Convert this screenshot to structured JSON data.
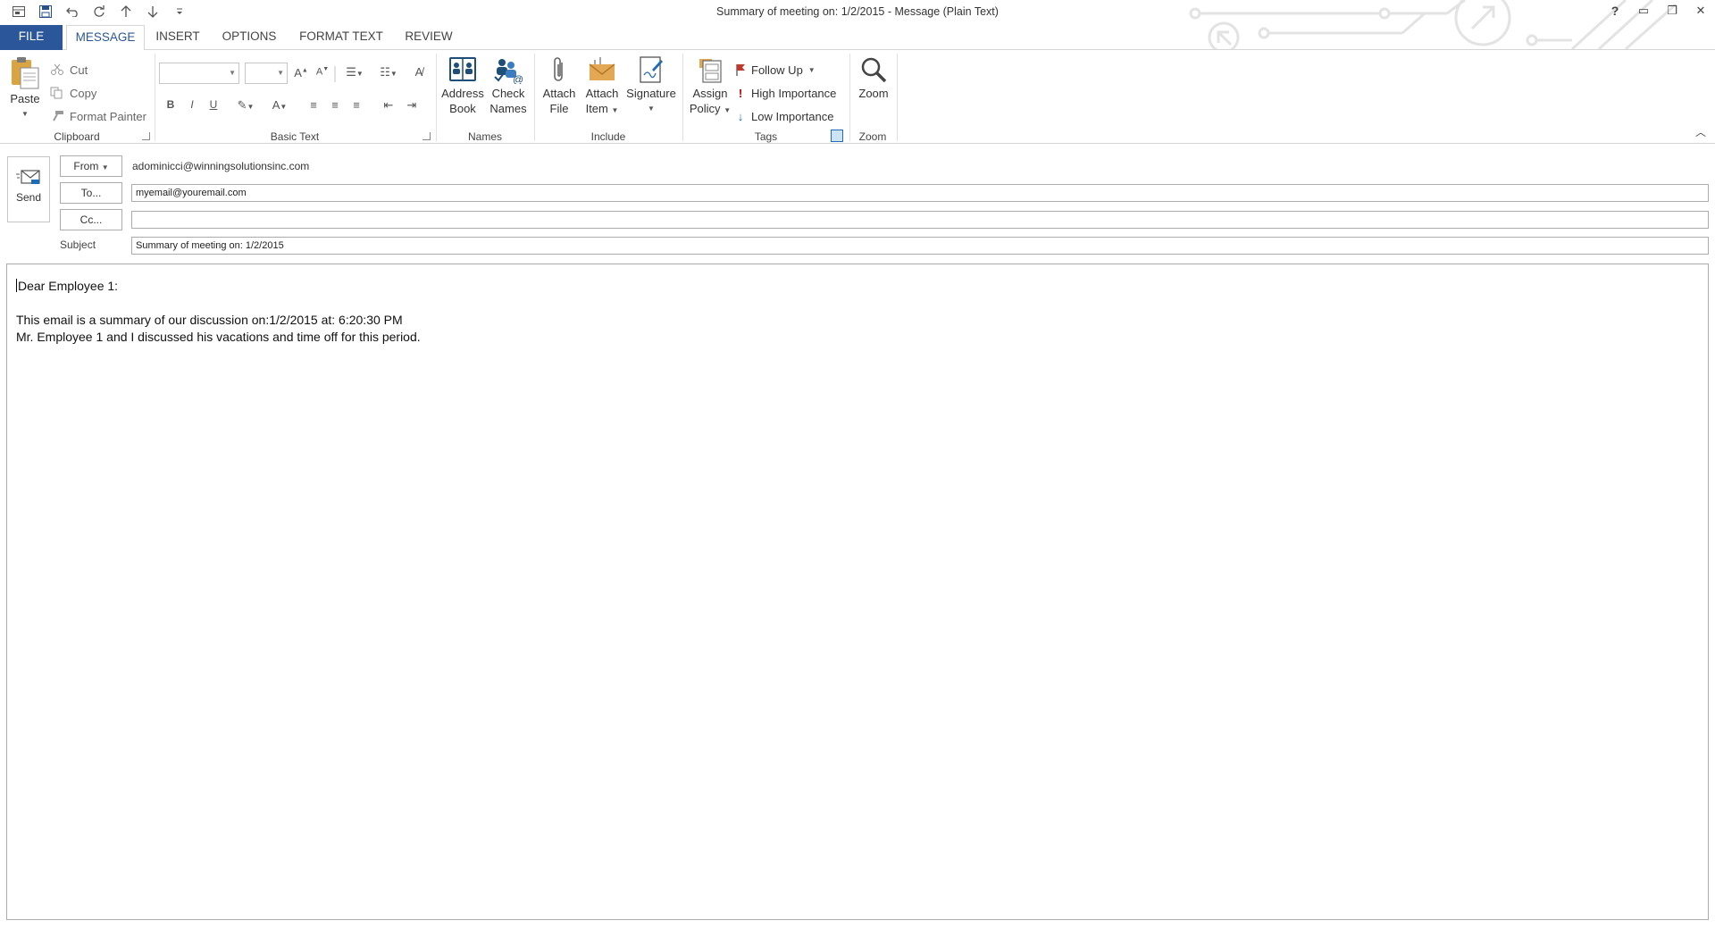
{
  "window": {
    "title": "Summary of meeting on: 1/2/2015 - Message (Plain Text)"
  },
  "quick_access": [
    {
      "name": "window-menu-icon"
    },
    {
      "name": "save-icon"
    },
    {
      "name": "undo-icon"
    },
    {
      "name": "redo-icon"
    },
    {
      "name": "up-arrow-icon"
    },
    {
      "name": "down-arrow-icon"
    },
    {
      "name": "customize-qat-icon"
    }
  ],
  "window_controls": {
    "help": "?",
    "ribbon_display": "▭",
    "restore": "❐",
    "close": "✕"
  },
  "tabs": [
    {
      "label": "FILE"
    },
    {
      "label": "MESSAGE"
    },
    {
      "label": "INSERT"
    },
    {
      "label": "OPTIONS"
    },
    {
      "label": "FORMAT TEXT"
    },
    {
      "label": "REVIEW"
    }
  ],
  "ribbon": {
    "clipboard": {
      "label": "Clipboard",
      "paste": "Paste",
      "cut": "Cut",
      "copy": "Copy",
      "format_painter": "Format Painter"
    },
    "basic_text": {
      "label": "Basic Text",
      "bold": "B",
      "italic": "I",
      "underline": "U"
    },
    "names": {
      "label": "Names",
      "address_book_1": "Address",
      "address_book_2": "Book",
      "check_names_1": "Check",
      "check_names_2": "Names"
    },
    "include": {
      "label": "Include",
      "attach_file_1": "Attach",
      "attach_file_2": "File",
      "attach_item_1": "Attach",
      "attach_item_2": "Item",
      "signature": "Signature"
    },
    "tags": {
      "label": "Tags",
      "assign_policy_1": "Assign",
      "assign_policy_2": "Policy",
      "follow_up": "Follow Up",
      "high_importance": "High Importance",
      "low_importance": "Low Importance"
    },
    "zoom": {
      "label": "Zoom",
      "zoom": "Zoom"
    }
  },
  "header": {
    "send_label": "Send",
    "from_label": "From",
    "from_value": "adominicci@winningsolutionsinc.com",
    "to_label": "To...",
    "to_value": "myemail@youremail.com",
    "cc_label": "Cc...",
    "cc_value": "",
    "subject_label": "Subject",
    "subject_value": "Summary of meeting on: 1/2/2015"
  },
  "body": {
    "line1": "Dear Employee 1:",
    "line2": "",
    "line3": "This email is a summary of our discussion on:1/2/2015 at: 6:20:30 PM",
    "line4": "Mr. Employee 1 and I discussed his vacations and time off for this period."
  },
  "colors": {
    "accent": "#2b579a",
    "flag": "#c0392b",
    "importance_high": "#c00000",
    "importance_low": "#1e6bb8"
  }
}
